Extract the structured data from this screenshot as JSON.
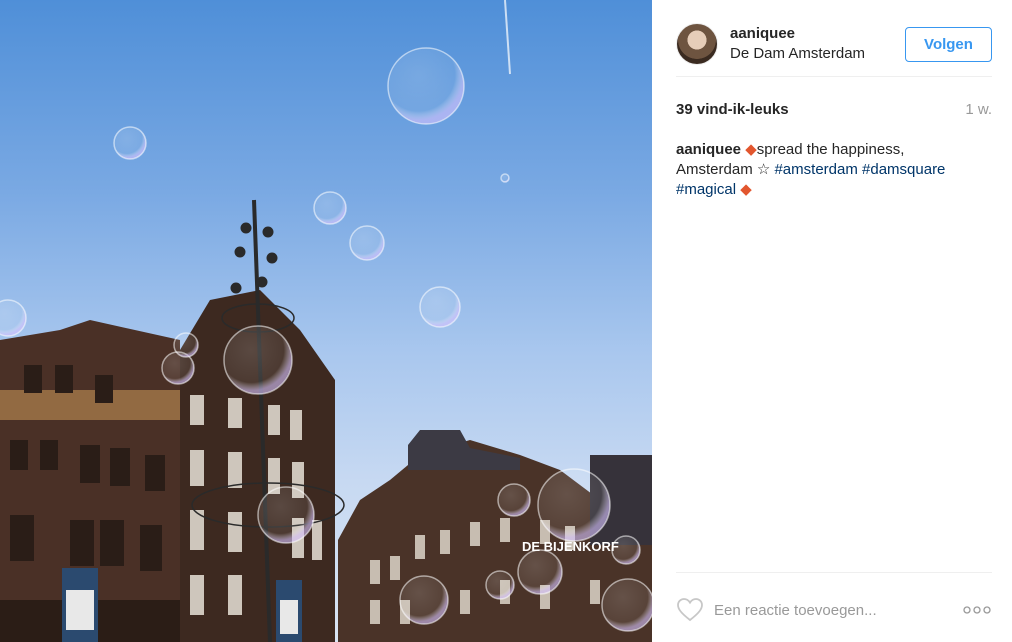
{
  "post": {
    "photo_alt": "",
    "header": {
      "username": "aaniquee",
      "location": "De Dam Amsterdam",
      "follow_label": "Volgen"
    },
    "likes": "39 vind-ik-leuks",
    "time": "1 w.",
    "caption": {
      "username": "aaniquee",
      "diamond": "◆",
      "text1": "spread the happiness,",
      "text2": "Amsterdam ☆ ",
      "tag1": "#amsterdam",
      "tag2": "#damsquare",
      "tag3": "#magical",
      "diamond2": "◆"
    },
    "comment": {
      "placeholder": "Een reactie toevoegen..."
    },
    "photo_text": {
      "store_sign": "DE BIJENKORF"
    },
    "colors": {
      "accent": "#3897f0",
      "hashtag": "#003569",
      "diamond": "#e2562e"
    },
    "icons": {
      "heart": "heart-outline-icon",
      "more": "more-options-icon"
    }
  }
}
